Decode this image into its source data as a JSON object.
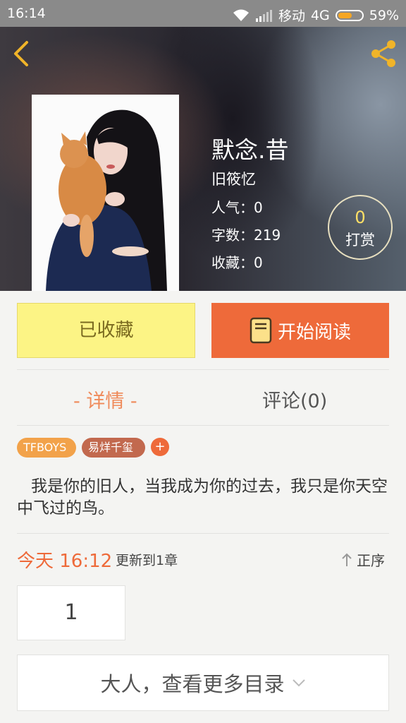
{
  "status_bar": {
    "time": "16:14",
    "carrier": "移动",
    "network": "4G",
    "battery": "59%",
    "battery_level": 0.59
  },
  "header": {
    "back_icon": "chevron-left-icon",
    "share_icon": "share-icon",
    "accent_color": "#f0b429"
  },
  "book": {
    "title": "默念.昔",
    "author": "旧筱忆",
    "popularity": "人气：0",
    "word_count": "字数：219",
    "favorites": "收藏：0",
    "reward_count": "0",
    "reward_label": "打赏"
  },
  "actions": {
    "collected_label": "已收藏",
    "read_label": "开始阅读",
    "read_icon": "book-icon"
  },
  "tabs": {
    "detail": "- 详情 -",
    "comments": "评论(0)"
  },
  "tags": [
    {
      "label": "TFBOYS",
      "color": "#f2a24a"
    },
    {
      "label": "易烊千玺",
      "color": "#c2694e"
    }
  ],
  "tag_add": "+",
  "intro": "我是你的旧人，当我成为你的过去，我只是你天空中飞过的鸟。",
  "update": {
    "today": "今天 16:12",
    "text": "更新到1章",
    "order_label": "正序"
  },
  "chapter": "1",
  "more_catalog": "大人，查看更多目录",
  "colors": {
    "primary": "#ee6a3a",
    "collected_bg": "#fcf485",
    "background": "#f4f4f2"
  }
}
